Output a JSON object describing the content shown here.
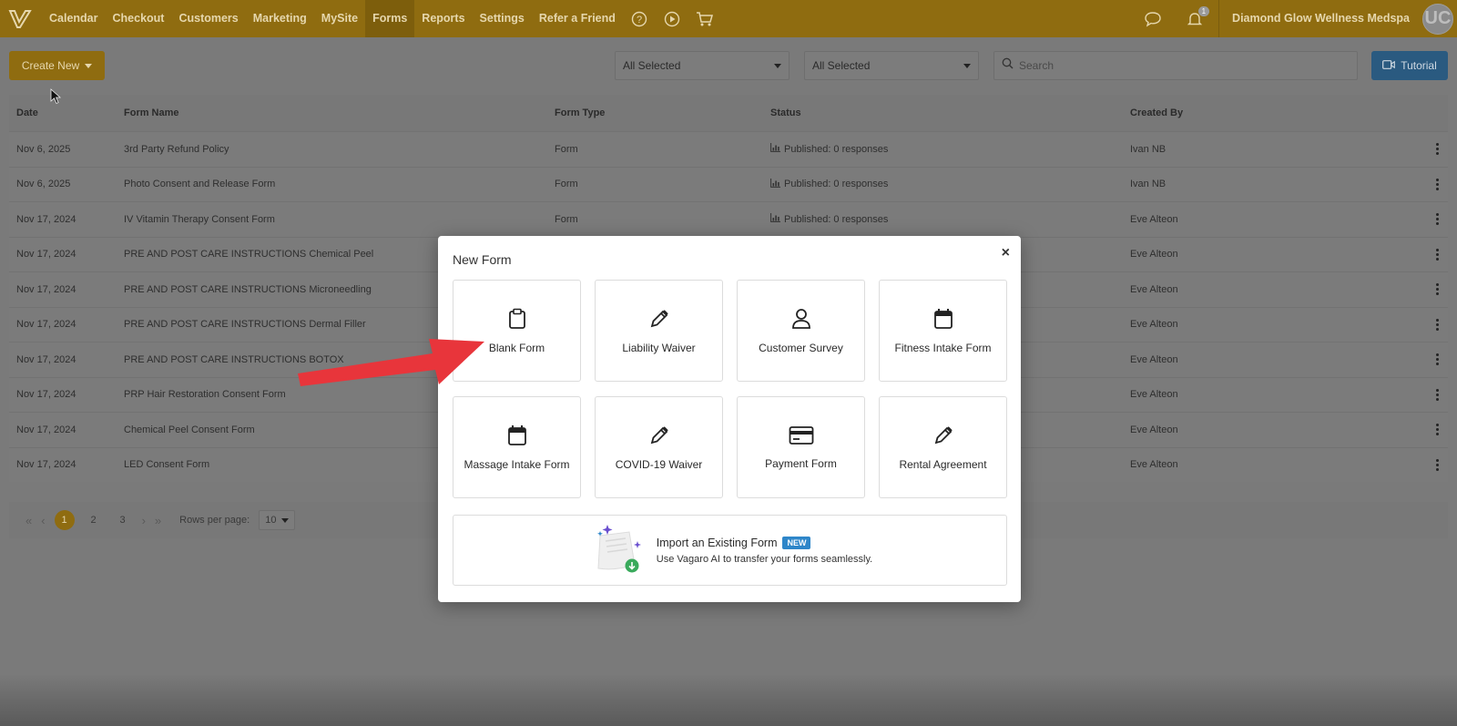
{
  "nav": {
    "items": [
      "Calendar",
      "Checkout",
      "Customers",
      "Marketing",
      "MySite",
      "Forms",
      "Reports",
      "Settings",
      "Refer a Friend"
    ],
    "active": "Forms",
    "business_name": "Diamond Glow Wellness Medspa",
    "notification_count": "1",
    "avatar_initials": "UC"
  },
  "toolbar": {
    "create_new_label": "Create New",
    "filter1_value": "All Selected",
    "filter2_value": "All Selected",
    "search_placeholder": "Search",
    "tutorial_label": "Tutorial"
  },
  "table": {
    "headers": {
      "date": "Date",
      "name": "Form Name",
      "type": "Form Type",
      "status": "Status",
      "created_by": "Created By"
    },
    "rows": [
      {
        "date": "Nov 6, 2025",
        "name": "3rd Party Refund Policy",
        "type": "Form",
        "status": "Published: 0 responses",
        "created_by": "Ivan NB"
      },
      {
        "date": "Nov 6, 2025",
        "name": "Photo Consent and Release Form",
        "type": "Form",
        "status": "Published: 0 responses",
        "created_by": "Ivan NB"
      },
      {
        "date": "Nov 17, 2024",
        "name": "IV Vitamin Therapy Consent Form",
        "type": "Form",
        "status": "Published: 0 responses",
        "created_by": "Eve Alteon"
      },
      {
        "date": "Nov 17, 2024",
        "name": "PRE AND POST CARE INSTRUCTIONS Chemical Peel",
        "type": "",
        "status": "",
        "created_by": "Eve Alteon"
      },
      {
        "date": "Nov 17, 2024",
        "name": "PRE AND POST CARE INSTRUCTIONS Microneedling",
        "type": "",
        "status": "",
        "created_by": "Eve Alteon"
      },
      {
        "date": "Nov 17, 2024",
        "name": "PRE AND POST CARE INSTRUCTIONS Dermal Filler",
        "type": "",
        "status": "",
        "created_by": "Eve Alteon"
      },
      {
        "date": "Nov 17, 2024",
        "name": "PRE AND POST CARE INSTRUCTIONS BOTOX",
        "type": "",
        "status": "",
        "created_by": "Eve Alteon"
      },
      {
        "date": "Nov 17, 2024",
        "name": "PRP Hair Restoration Consent Form",
        "type": "",
        "status": "",
        "created_by": "Eve Alteon"
      },
      {
        "date": "Nov 17, 2024",
        "name": "Chemical Peel Consent Form",
        "type": "",
        "status": "",
        "created_by": "Eve Alteon"
      },
      {
        "date": "Nov 17, 2024",
        "name": "LED Consent Form",
        "type": "",
        "status": "",
        "created_by": "Eve Alteon"
      }
    ]
  },
  "pagination": {
    "pages": [
      "1",
      "2",
      "3"
    ],
    "current": "1",
    "rows_per_page_label": "Rows per page:",
    "rows_per_page_value": "10"
  },
  "modal": {
    "title": "New Form",
    "close": "×",
    "tiles": [
      {
        "label": "Blank Form",
        "icon": "clipboard-icon"
      },
      {
        "label": "Liability Waiver",
        "icon": "pen-icon"
      },
      {
        "label": "Customer Survey",
        "icon": "person-icon"
      },
      {
        "label": "Fitness Intake Form",
        "icon": "calendar-icon"
      },
      {
        "label": "Massage Intake Form",
        "icon": "calendar-icon"
      },
      {
        "label": "COVID-19 Waiver",
        "icon": "pen-icon"
      },
      {
        "label": "Payment Form",
        "icon": "credit-card-icon"
      },
      {
        "label": "Rental Agreement",
        "icon": "pen-icon"
      }
    ],
    "import": {
      "title": "Import an Existing Form",
      "badge": "NEW",
      "subtitle": "Use Vagaro AI to transfer your forms seamlessly."
    }
  },
  "colors": {
    "brand": "#8f6c10",
    "tutorial": "#2a5a80",
    "new_badge": "#2e86c9",
    "arrow": "#e8353b"
  }
}
